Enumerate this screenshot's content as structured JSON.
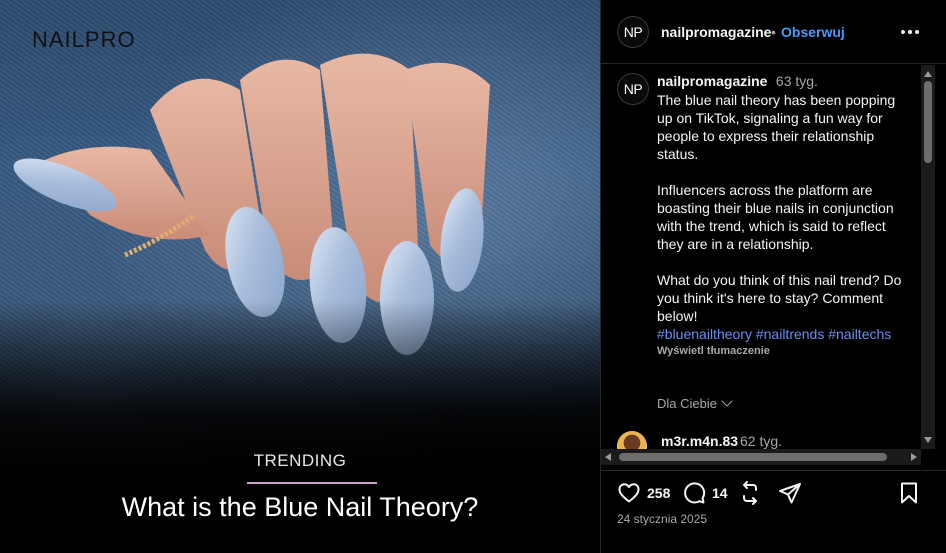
{
  "media": {
    "brand": "NAILPRO",
    "kicker": "TRENDING",
    "headline": "What is the Blue Nail Theory?"
  },
  "header": {
    "avatar_text": "NP",
    "username": "nailpromagazine",
    "separator": "•",
    "follow_label": "Obserwuj",
    "more_icon": "more-horizontal-icon"
  },
  "caption": {
    "avatar_text": "NP",
    "username": "nailpromagazine",
    "time": "63 tyg.",
    "text": "The blue nail theory has been popping up on TikTok, signaling a fun way for people to express their relationship status.\n\nInfluencers across the platform are boasting their blue nails in conjunction with the trend, which is said to reflect they are in a relationship.\n\nWhat do you think of this nail trend? Do you think it's here to stay? Comment below!\n",
    "hashtags": "#bluenailtheory #nailtrends #nailtechs",
    "translate_label": "Wyświetl tłumaczenie"
  },
  "for_you_label": "Dla Ciebie",
  "comments": [
    {
      "username": "m3r.m4n.83",
      "time": "62 tyg."
    }
  ],
  "actions": {
    "like_icon": "heart-icon",
    "like_count": "258",
    "comment_icon": "comment-icon",
    "comment_count": "14",
    "repost_icon": "repost-icon",
    "share_icon": "send-icon",
    "save_icon": "bookmark-icon"
  },
  "date": "24 stycznia 2025",
  "colors": {
    "background": "#000000",
    "accent_link": "#4a9bf5",
    "hashtag": "#6a8cf0",
    "muted_text": "#a8a8a8",
    "divider": "#262626"
  }
}
